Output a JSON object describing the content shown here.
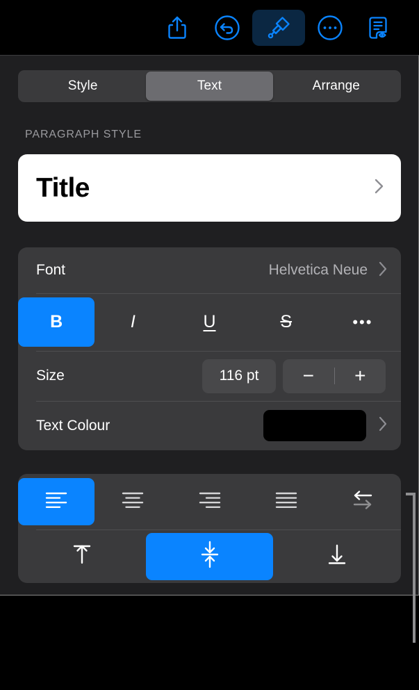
{
  "toolbar": {
    "buttons": [
      {
        "name": "share-icon",
        "label": "Share",
        "active": false
      },
      {
        "name": "undo-icon",
        "label": "Undo",
        "active": false
      },
      {
        "name": "format-brush-icon",
        "label": "Format",
        "active": true
      },
      {
        "name": "more-icon",
        "label": "More",
        "active": false
      },
      {
        "name": "document-preview-icon",
        "label": "Document Options",
        "active": false
      }
    ]
  },
  "segmented": {
    "options": [
      "Style",
      "Text",
      "Arrange"
    ],
    "selected": "Text"
  },
  "paragraph_style": {
    "section_label": "PARAGRAPH STYLE",
    "value": "Title",
    "chevron": "›"
  },
  "font": {
    "label": "Font",
    "value": "Helvetica Neue",
    "chevron": "›"
  },
  "text_styles": [
    {
      "name": "bold-button",
      "glyph": "B",
      "active": true
    },
    {
      "name": "italic-button",
      "glyph": "I",
      "active": false
    },
    {
      "name": "underline-button",
      "glyph": "U",
      "active": false
    },
    {
      "name": "strikethrough-button",
      "glyph": "S",
      "active": false
    },
    {
      "name": "more-text-options-button",
      "glyph": "•••",
      "active": false
    }
  ],
  "size": {
    "label": "Size",
    "value": "116 pt",
    "decrement": "−",
    "increment": "+"
  },
  "text_colour": {
    "label": "Text Colour",
    "swatch_colour": "#000000",
    "chevron": "›"
  },
  "alignment": {
    "horizontal": [
      {
        "name": "align-left-button",
        "active": true
      },
      {
        "name": "align-center-button",
        "active": false
      },
      {
        "name": "align-right-button",
        "active": false
      },
      {
        "name": "align-justify-button",
        "active": false
      },
      {
        "name": "text-direction-button",
        "active": false
      }
    ],
    "vertical": [
      {
        "name": "align-top-button",
        "active": false
      },
      {
        "name": "align-middle-button",
        "active": true
      },
      {
        "name": "align-bottom-button",
        "active": false
      }
    ]
  },
  "colors": {
    "accent_blue": "#0a84ff",
    "toolbar_icon_blue": "#0a84ff",
    "panel_background": "#1f1f21",
    "card_background": "#3a3a3c",
    "segment_selected": "#6c6c70"
  }
}
